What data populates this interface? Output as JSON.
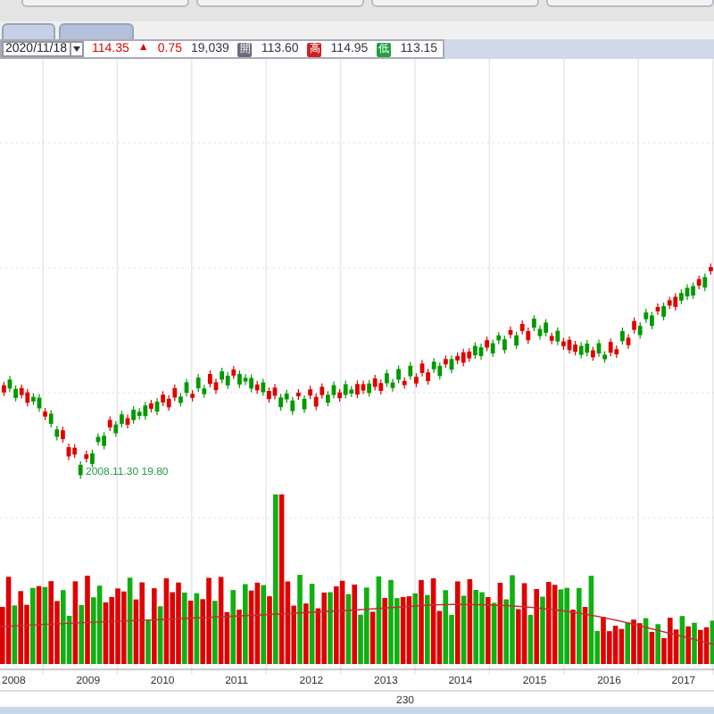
{
  "tabs": [
    {
      "selected": false
    },
    {
      "selected": true
    }
  ],
  "quote_bar": {
    "date": "2020/11/18",
    "fields": [
      {
        "kind": "value",
        "text": "114.35",
        "color": "#e00000"
      },
      {
        "kind": "arrow",
        "text": "▲",
        "color": "#e00000"
      },
      {
        "kind": "value",
        "text": "0.75",
        "color": "#e00000"
      },
      {
        "kind": "value",
        "text": "19,039",
        "color": "#333333"
      },
      {
        "kind": "badge",
        "text": "開",
        "color": "#6b6b7a"
      },
      {
        "kind": "value",
        "text": "113.60",
        "color": "#333333"
      },
      {
        "kind": "badge",
        "text": "高",
        "color": "#d02020"
      },
      {
        "kind": "value",
        "text": "114.95",
        "color": "#333333"
      },
      {
        "kind": "badge",
        "text": "低",
        "color": "#20a040"
      },
      {
        "kind": "value",
        "text": "113.15",
        "color": "#333333"
      }
    ]
  },
  "price_chart": {
    "annotation": "2008.11.30  19.80",
    "x_labels": [
      "2008",
      "2009",
      "2010",
      "2011",
      "2012",
      "2013",
      "2014",
      "2015",
      "2016",
      "2017"
    ],
    "footer": "230"
  }
}
